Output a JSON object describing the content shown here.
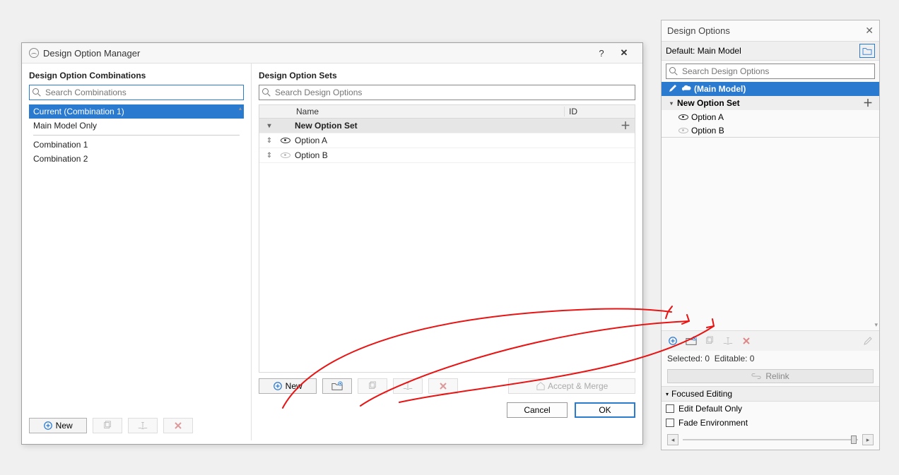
{
  "manager": {
    "title": "Design Option Manager",
    "help": "?",
    "close": "✕",
    "left": {
      "section": "Design Option Combinations",
      "search_placeholder": "Search Combinations",
      "items": [
        {
          "label": "Current (Combination 1)",
          "selected": true
        },
        {
          "label": "Main Model Only",
          "selected": false
        }
      ],
      "extra_items": [
        {
          "label": "Combination 1"
        },
        {
          "label": "Combination 2"
        }
      ],
      "buttons": {
        "new": "New"
      }
    },
    "right": {
      "section": "Design Option Sets",
      "search_placeholder": "Search Design Options",
      "columns": {
        "name": "Name",
        "id": "ID"
      },
      "set": {
        "name": "New Option Set"
      },
      "options": [
        {
          "name": "Option A",
          "visible": true
        },
        {
          "name": "Option B",
          "visible": false
        }
      ],
      "buttons": {
        "new": "New",
        "accept_merge": "Accept & Merge"
      },
      "footer": {
        "cancel": "Cancel",
        "ok": "OK"
      }
    }
  },
  "panel": {
    "title": "Design Options",
    "default_label": "Default:",
    "default_value": "Main Model",
    "search_placeholder": "Search Design Options",
    "main_model": "(Main Model)",
    "set": "New Option Set",
    "options": [
      {
        "name": "Option A",
        "visible": true
      },
      {
        "name": "Option B",
        "visible": false
      }
    ],
    "status": {
      "selected_label": "Selected:",
      "selected": "0",
      "editable_label": "Editable:",
      "editable": "0"
    },
    "relink": "Relink",
    "focused_editing": "Focused Editing",
    "checkboxes": {
      "edit_default": "Edit Default Only",
      "fade_env": "Fade Environment"
    }
  },
  "colors": {
    "accent": "#2a7ad0",
    "danger": "#cc4444",
    "annotation": "#e81313"
  }
}
